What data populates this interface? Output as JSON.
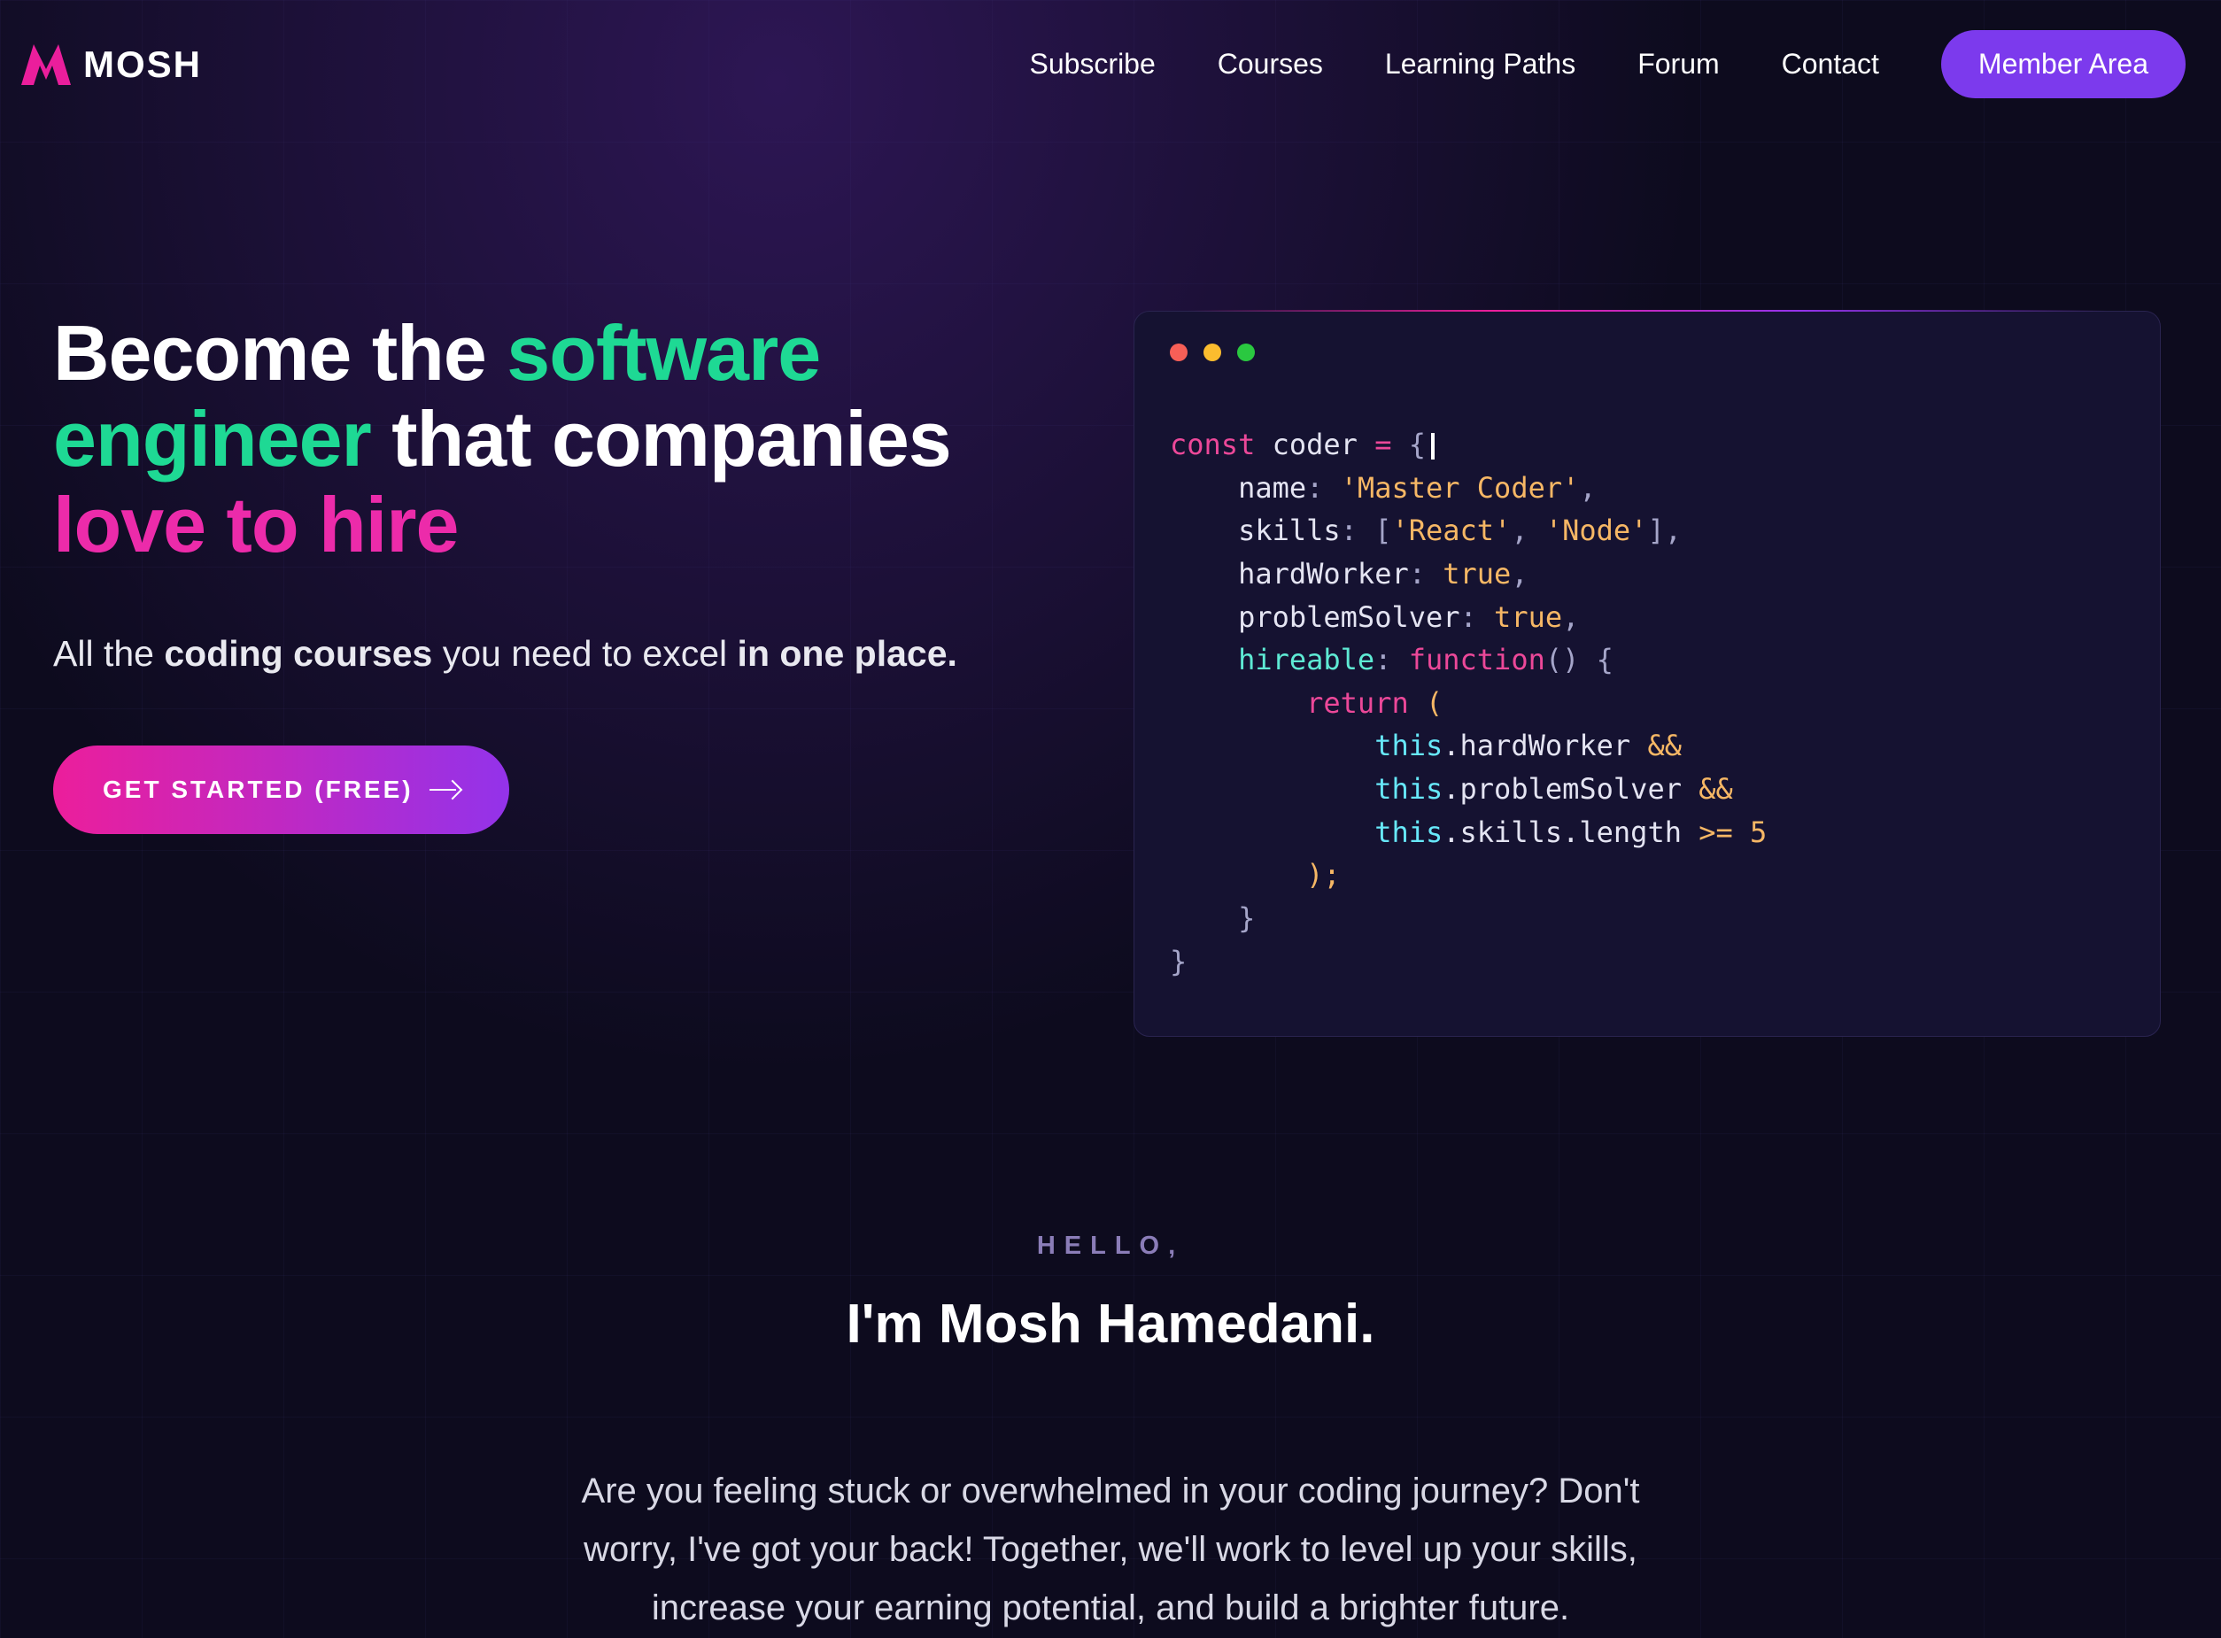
{
  "header": {
    "brand": "MOSH",
    "nav": [
      "Subscribe",
      "Courses",
      "Learning Paths",
      "Forum",
      "Contact"
    ],
    "member_btn": "Member Area"
  },
  "hero": {
    "h1_a": "Become the ",
    "h1_b": "software engineer",
    "h1_c": " that companies ",
    "h1_d": "love to hire",
    "sub_a": "All the ",
    "sub_b": "coding courses",
    "sub_c": " you need to excel ",
    "sub_d": "in one place.",
    "cta": "GET STARTED (FREE)"
  },
  "code": {
    "l1a": "const",
    "l1b": " coder ",
    "l1c": "=",
    "l1d": " {",
    "l2a": "    name",
    "l2b": ":",
    "l2c": " 'Master Coder'",
    "l2d": ",",
    "l3a": "    skills",
    "l3b": ":",
    "l3c": " [",
    "l3d": "'React'",
    "l3e": ",",
    "l3f": " 'Node'",
    "l3g": "]",
    "l3h": ",",
    "l4a": "    hardWorker",
    "l4b": ":",
    "l4c": " true",
    "l4d": ",",
    "l5a": "    problemSolver",
    "l5b": ":",
    "l5c": " true",
    "l5d": ",",
    "l6a": "    hireable",
    "l6b": ":",
    "l6c": " function",
    "l6d": "()",
    "l6e": " {",
    "l7a": "        ",
    "l7b": "return",
    "l7c": " (",
    "l8a": "            ",
    "l8b": "this",
    "l8c": ".hardWorker ",
    "l8d": "&&",
    "l9a": "            ",
    "l9b": "this",
    "l9c": ".problemSolver ",
    "l9d": "&&",
    "l10a": "            ",
    "l10b": "this",
    "l10c": ".skills.length ",
    "l10d": ">=",
    "l10e": " 5",
    "l11": "        );",
    "l12": "    }",
    "l13": "}"
  },
  "intro": {
    "eyebrow": "HELLO,",
    "title": "I'm Mosh Hamedani.",
    "body": "Are you feeling stuck or overwhelmed in your coding journey? Don't worry, I've got your back! Together, we'll work to level up your skills, increase your earning potential, and build a brighter future."
  }
}
